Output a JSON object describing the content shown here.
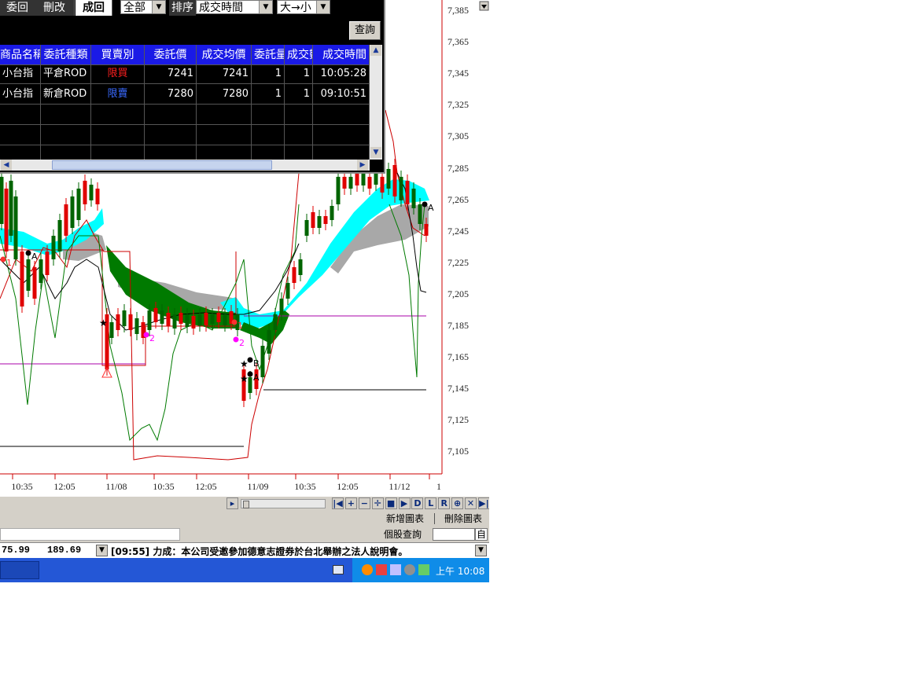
{
  "order_window": {
    "tabs": [
      {
        "label": "委回",
        "active": false
      },
      {
        "label": "刪改",
        "active": false
      },
      {
        "label": "成回",
        "active": true
      }
    ],
    "filter_value": "全部",
    "sort_label": "排序",
    "sort_by_value": "成交時間",
    "sort_order_value": "大→小",
    "query_button": "查詢",
    "columns": [
      "商品名稱",
      "委託種類",
      "買賣別",
      "委託價",
      "成交均價",
      "委託量",
      "成交數",
      "成交時間"
    ],
    "rows": [
      {
        "product": "小台指",
        "order_type": "平倉ROD",
        "side": "限買",
        "side_color": "#ff2020",
        "order_price": "7241",
        "avg_price": "7241",
        "order_qty": "1",
        "fill_qty": "1",
        "fill_time": "10:05:28"
      },
      {
        "product": "小台指",
        "order_type": "新倉ROD",
        "side": "限賣",
        "side_color": "#3a6aff",
        "order_price": "7280",
        "avg_price": "7280",
        "order_qty": "1",
        "fill_qty": "1",
        "fill_time": "09:10:51"
      }
    ]
  },
  "chart": {
    "price_axis": [
      "7,385",
      "7,365",
      "7,345",
      "7,325",
      "7,305",
      "7,285",
      "7,265",
      "7,245",
      "7,225",
      "7,205",
      "7,185",
      "7,165",
      "7,145",
      "7,125",
      "7,105"
    ],
    "time_axis": [
      "10:35",
      "12:05",
      "11/08",
      "10:35",
      "12:05",
      "11/09",
      "10:35",
      "12:05",
      "11/12",
      "1"
    ],
    "markers": [
      "1",
      "A",
      "2",
      "2",
      "1",
      "B",
      "A",
      "A"
    ],
    "colors": {
      "cloud_up": "#00ffff",
      "cloud_down": "#007a00",
      "cloud_gray": "#a8a8a8",
      "candle_up": "#e00000",
      "candle_down": "#006400"
    }
  },
  "toolbar": {
    "buttons": [
      "|◀",
      "+",
      "−",
      "✛",
      "■",
      "▶",
      "D",
      "L",
      "R",
      "⊕",
      "✕",
      "▶|"
    ],
    "add_chart": "新增圖表",
    "delete_chart": "刪除圖表",
    "stock_query_label": "個股查詢",
    "stock_query_value": "",
    "auto_button": "自"
  },
  "ticker": {
    "value1": "75.99",
    "value2": "189.69",
    "news": "[09:55] 力成：本公司受邀參加德意志證券於台北舉辦之法人說明會。"
  },
  "taskbar": {
    "clock": "上午 10:08"
  }
}
